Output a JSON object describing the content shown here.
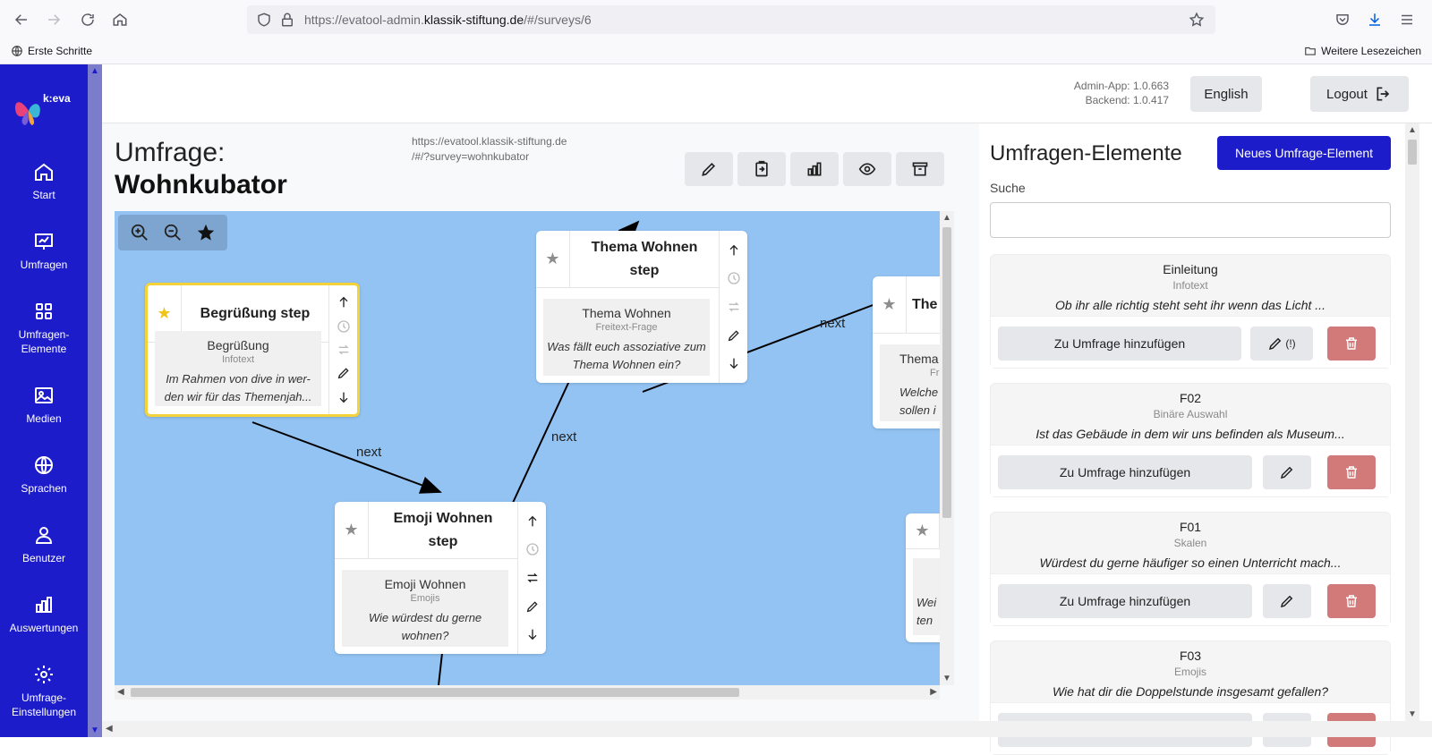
{
  "browser": {
    "url_prefix": "https://evatool-admin.",
    "url_domain": "klassik-stiftung.de",
    "url_path": "/#/surveys/6",
    "bookmark_left": "Erste Schritte",
    "bookmark_right": "Weitere Lesezeichen"
  },
  "sidebar": {
    "logo_text": "k:eva",
    "items": [
      {
        "label": "Start",
        "icon": "home-icon"
      },
      {
        "label": "Umfragen",
        "icon": "chart-presentation-icon"
      },
      {
        "label": "Umfragen-Elemente",
        "icon": "grid-icon"
      },
      {
        "label": "Medien",
        "icon": "image-icon"
      },
      {
        "label": "Sprachen",
        "icon": "globe-icon"
      },
      {
        "label": "Benutzer",
        "icon": "users-icon"
      },
      {
        "label": "Auswertungen",
        "icon": "bar-chart-icon"
      },
      {
        "label": "Umfrage-Einstellungen",
        "icon": "gear-icon"
      }
    ]
  },
  "header": {
    "version_admin": "Admin-App: 1.0.663",
    "version_backend": "Backend: 1.0.417",
    "language_button": "English",
    "logout_button": "Logout"
  },
  "survey": {
    "title_label": "Umfrage:",
    "name": "Wohnkubator",
    "url_line1": "https://evatool.klassik-stiftung.de",
    "url_line2": "/#/?survey=wohnkubator"
  },
  "graph": {
    "edge_label": "next",
    "nodes": [
      {
        "title": "Begrüßung step",
        "name": "Begrüßung",
        "type": "Infotext",
        "text": "Im Rahmen von dive in wer-den wir für das Themenjah..."
      },
      {
        "title": "Thema Wohnen step",
        "name": "Thema Wohnen",
        "type": "Freitext-Frage",
        "text": "Was fällt euch assoziative zum Thema Wohnen ein?"
      },
      {
        "title": "Emoji Wohnen step",
        "name": "Emoji Wohnen",
        "type": "Emojis",
        "text": "Wie würdest du gerne wohnen?"
      },
      {
        "title": "The",
        "name": "Thema",
        "type": "Fr",
        "text": "Welche th sollen i"
      },
      {
        "title": "",
        "name": "",
        "type": "",
        "text": "Wei ten"
      }
    ]
  },
  "elements_panel": {
    "title": "Umfragen-Elemente",
    "new_button": "Neues Umfrage-Element",
    "search_label": "Suche",
    "search_value": "",
    "add_label": "Zu Umfrage hinzufügen",
    "warn_label": "(!)",
    "items": [
      {
        "name": "Einleitung",
        "type": "Infotext",
        "text": "Ob ihr alle richtig steht seht ihr wenn das Licht ..."
      },
      {
        "name": "F02",
        "type": "Binäre Auswahl",
        "text": "Ist das Gebäude in dem wir uns befinden als Museum..."
      },
      {
        "name": "F01",
        "type": "Skalen",
        "text": "Würdest du gerne häufiger so einen Unterricht mach..."
      },
      {
        "name": "F03",
        "type": "Emojis",
        "text": "Wie hat dir die Doppelstunde insgesamt gefallen?"
      }
    ]
  }
}
